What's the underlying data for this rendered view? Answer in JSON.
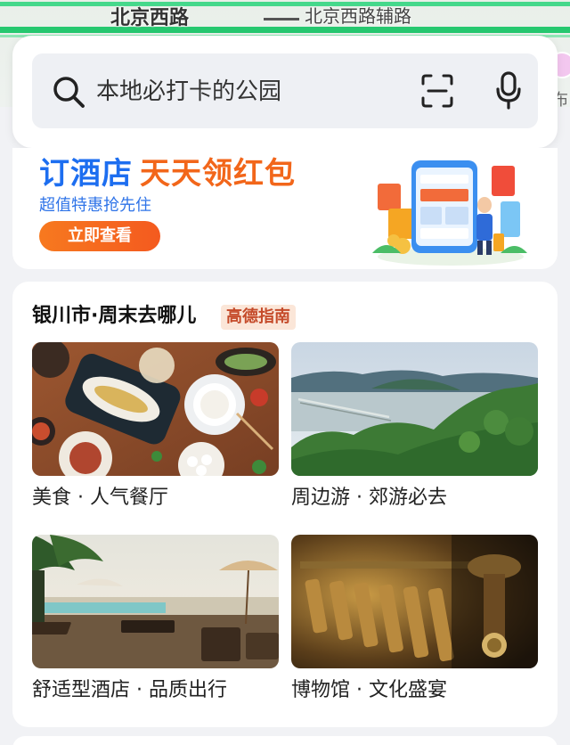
{
  "map": {
    "road_label_main": "北京西路",
    "road_label_aux": "北京西路辅路",
    "edge_label": "布"
  },
  "search": {
    "placeholder": "本地必打卡的公园",
    "icons": [
      "search-icon",
      "scan-icon",
      "microphone-icon"
    ]
  },
  "banner": {
    "title_part1": "订酒店",
    "title_part2": "天天领红包",
    "subtitle": "超值特惠抢先住",
    "button": "立即查看",
    "colors": {
      "title_blue": "#1d6ef0",
      "title_orange": "#f2661a",
      "button": "#f45a1f"
    }
  },
  "guide": {
    "title": "银川市·周末去哪儿",
    "badge": "高德指南",
    "tiles": [
      {
        "label": "美食 · 人气餐厅",
        "image": "food-table-photo"
      },
      {
        "label": "周边游 · 郊游必去",
        "image": "lake-bridge-photo"
      },
      {
        "label": "舒适型酒店 · 品质出行",
        "image": "resort-pool-photo"
      },
      {
        "label": "博物馆 · 文化盛宴",
        "image": "museum-artifacts-photo"
      }
    ]
  }
}
